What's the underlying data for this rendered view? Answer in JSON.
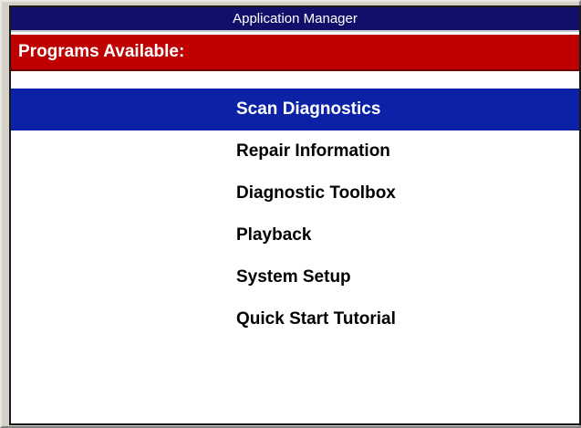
{
  "window": {
    "title": "Application Manager"
  },
  "section": {
    "header": "Programs Available:"
  },
  "programs": {
    "selected_index": 0,
    "items": [
      {
        "label": "Scan Diagnostics"
      },
      {
        "label": "Repair Information"
      },
      {
        "label": "Diagnostic Toolbox"
      },
      {
        "label": "Playback"
      },
      {
        "label": "System Setup"
      },
      {
        "label": "Quick Start Tutorial"
      }
    ]
  },
  "colors": {
    "title_bar": "#10106b",
    "section_header": "#bf0000",
    "selection": "#0b22a6",
    "frame": "#d4d0c8"
  }
}
